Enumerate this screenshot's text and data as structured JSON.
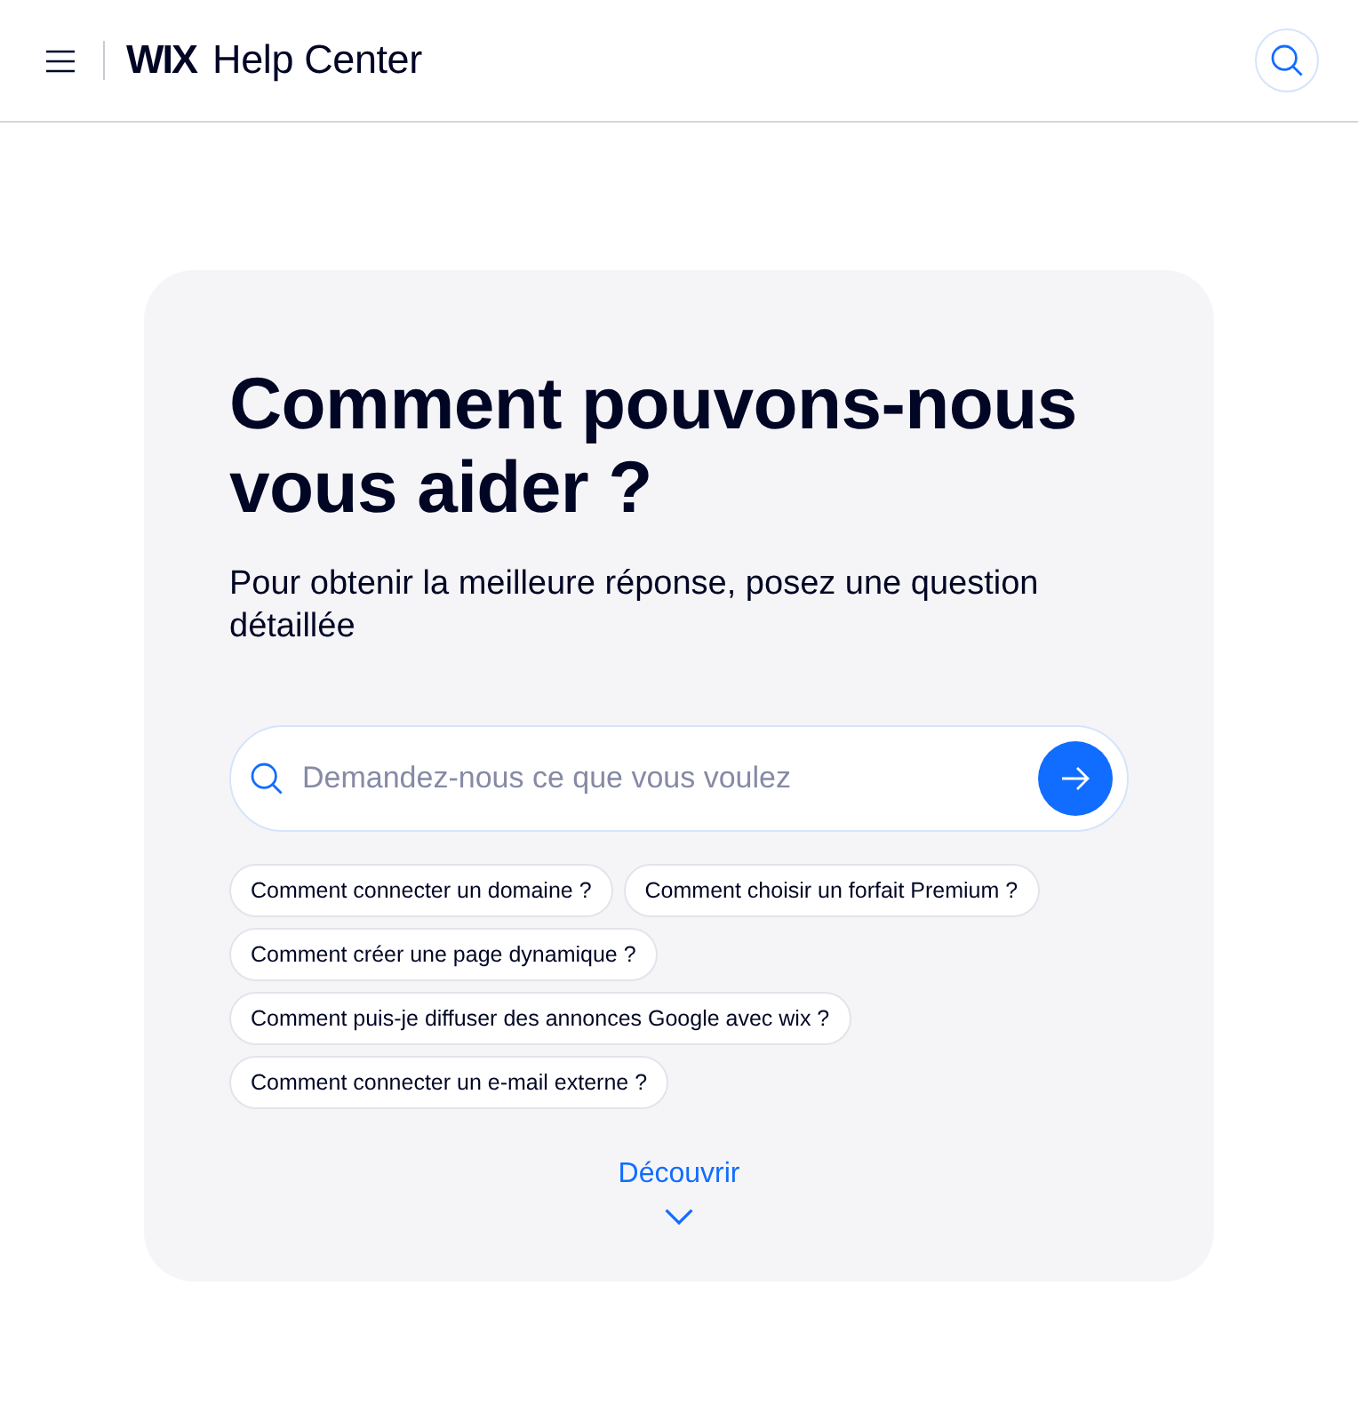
{
  "header": {
    "logo": "**WIX** Help Center"
  },
  "hero": {
    "title": "Comment pouvons-nous vous aider ?",
    "subtitle": "Pour obtenir la meilleure réponse, posez une question détaillée",
    "search": {
      "placeholder": "Demandez-nous ce que vous voulez"
    },
    "suggestions": [
      "Comment connecter un domaine ?",
      "Comment choisir un forfait Premium ?",
      "Comment créer une page dynamique ?",
      "Comment puis-je diffuser des annonces Google avec wix ?",
      "Comment connecter un e-mail externe ?"
    ],
    "discover": "Découvrir"
  }
}
